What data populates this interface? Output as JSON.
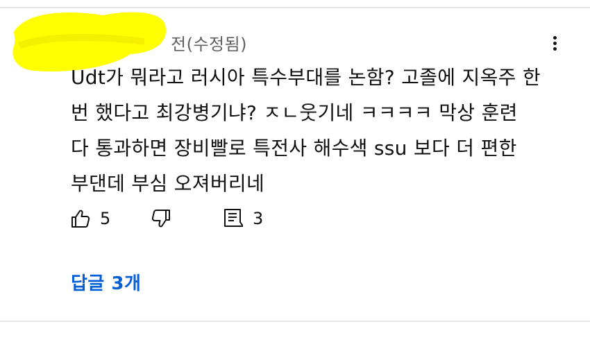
{
  "comment": {
    "meta": "전(수정됨)",
    "text": "Udt가 뭐라고 러시아 특수부대를 논함? 고졸에 지옥주 한\n번 했다고 최강병기냐? ㅈㄴ웃기네 ㅋㅋㅋㅋ 막상 훈련\n다 통과하면 장비빨로 특전사 해수색 ssu 보다 더 편한\n부댄데 부심 오져버리네",
    "likes": "5",
    "replies_count": "3",
    "replies_link": "답글 3개"
  },
  "icons": {
    "like": "thumbs-up-icon",
    "dislike": "thumbs-down-icon",
    "reply": "comment-icon",
    "more": "more-vert-icon"
  },
  "colors": {
    "link": "#065fd4",
    "redaction": "#ffff00",
    "meta": "#606060"
  }
}
